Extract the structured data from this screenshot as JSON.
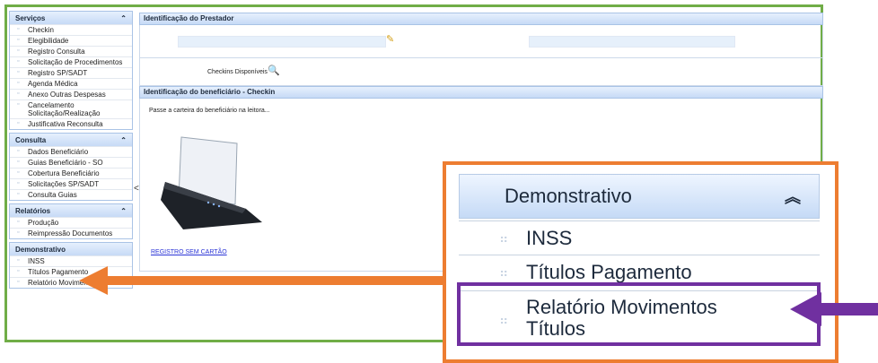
{
  "sidebar": {
    "sections": [
      {
        "title": "Serviços",
        "chevron": "⌃",
        "items": [
          "Checkin",
          "Elegibilidade",
          "Registro Consulta",
          "Solicitação de Procedimentos",
          "Registro SP/SADT",
          "Agenda Médica",
          "Anexo Outras Despesas",
          "Cancelamento Solicitação/Realização",
          "Justificativa Reconsulta"
        ]
      },
      {
        "title": "Consulta",
        "chevron": "⌃",
        "items": [
          "Dados Beneficiário",
          "Guias Beneficiário - SO",
          "Cobertura Beneficiário",
          "Solicitações SP/SADT",
          "Consulta Guias"
        ]
      },
      {
        "title": "Relatórios",
        "chevron": "⌃",
        "items": [
          "Produção",
          "Reimpressão Documentos"
        ]
      },
      {
        "title": "Demonstrativo",
        "chevron": "",
        "items": [
          "INSS",
          "Títulos Pagamento",
          "Relatório Movimentos Títulos"
        ]
      }
    ],
    "collapse_glyph": "<"
  },
  "main": {
    "prestador_title": "Identificação do Prestador",
    "checkins_label": "Checkins Disponíveis",
    "beneficiario_title": "Identificação do beneficiário - Checkin",
    "instruction": "Passe a carteira do beneficiário na leitora...",
    "no_card_link": "REGISTRO SEM CARTÃO"
  },
  "zoom": {
    "title": "Demonstrativo",
    "chevron": "≈",
    "items": [
      "INSS",
      "Títulos Pagamento",
      "Relatório Movimentos Títulos"
    ]
  },
  "colors": {
    "green_frame": "#70ad47",
    "orange_frame": "#ed7d31",
    "purple_frame": "#7030a0"
  }
}
